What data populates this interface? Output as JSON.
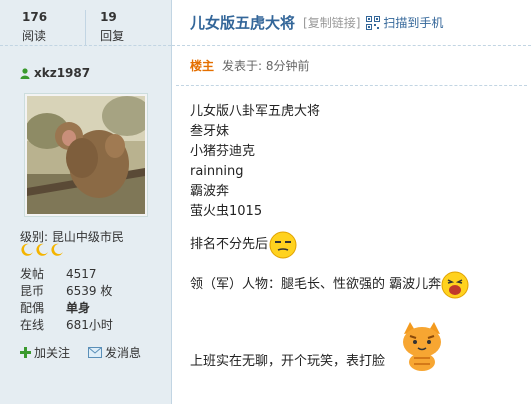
{
  "stats": {
    "views": "176",
    "views_label": "阅读",
    "replies": "19",
    "replies_label": "回复"
  },
  "user": {
    "name": "xkz1987",
    "level_label": "级别:",
    "level_value": "昆山中级市民"
  },
  "info": [
    {
      "key": "发帖",
      "value": "4517"
    },
    {
      "key": "昆币",
      "value": "6539 枚"
    },
    {
      "key": "配偶",
      "value": "单身"
    },
    {
      "key": "在线",
      "value": "681小时"
    }
  ],
  "actions": {
    "follow": "加关注",
    "message": "发消息"
  },
  "post": {
    "title": "儿女版五虎大将",
    "copy_link": "[复制链接]",
    "scan_to_phone": "扫描到手机",
    "badge": "楼主",
    "posted": "发表于: 8分钟前",
    "lines": [
      "儿女版八卦军五虎大将",
      "叁牙妹",
      "小猪芬迪克",
      "rainning",
      "霸波奔",
      "萤火虫1015"
    ],
    "ranking": "排名不分先后",
    "leader": "领（军）人物：腿毛长、性欲强的 霸波儿奔",
    "closing": "上班实在无聊，开个玩笑，表打脸"
  },
  "colors": {
    "sidebar_bg": "#e5edf2",
    "title": "#336699",
    "badge": "#e46f00",
    "border": "#c2d5e3"
  }
}
